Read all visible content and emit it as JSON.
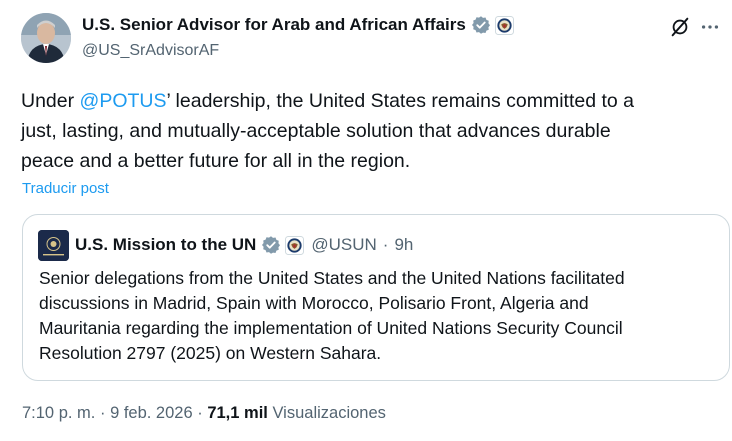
{
  "author": {
    "display_name": "U.S. Senior Advisor for Arab and African Affairs",
    "handle": "@US_SrAdvisorAF"
  },
  "icons": {
    "verified_badge": "gray-verified-badge-icon",
    "affiliate_seal": "department-of-state-seal-icon",
    "grok": "grok-slash-icon",
    "more": "more-dots-icon"
  },
  "tweet": {
    "lines": [
      {
        "before": "Under ",
        "mention": "@POTUS",
        "after": "’ leadership, the United States remains committed to a"
      },
      {
        "before": "just, lasting, and mutually-acceptable solution that advances durable",
        "mention": "",
        "after": ""
      },
      {
        "before": "peace and a better future for all in the region.",
        "mention": "",
        "after": ""
      }
    ],
    "translate_label": "Traducir post"
  },
  "quote": {
    "avatar_text": "U.S. MISSION",
    "display_name": "U.S. Mission to the UN",
    "handle": "@USUN",
    "separator": "·",
    "time": "9h",
    "lines": [
      "Senior delegations from the United States and the United Nations facilitated",
      "discussions in Madrid, Spain with Morocco, Polisario Front, Algeria and",
      "Mauritania regarding the implementation of United Nations Security Council",
      "Resolution 2797 (2025) on Western Sahara."
    ]
  },
  "footer": {
    "time": "7:10 p. m.",
    "separator": "·",
    "date": "9 feb. 2026",
    "views_count": "71,1 mil",
    "views_label": "Visualizaciones"
  },
  "colors": {
    "accent": "#1d9bf0",
    "text_primary": "#0f1419",
    "text_secondary": "#536471",
    "border": "#cfd9de",
    "badge_gray": "#829aab"
  }
}
